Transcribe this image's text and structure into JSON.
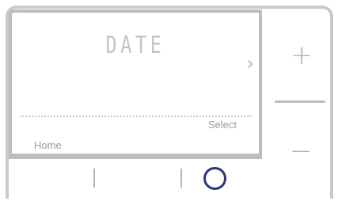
{
  "screen": {
    "title": "DATE",
    "next_glyph": "›",
    "select_label": "Select",
    "home_label": "Home"
  },
  "controls": {
    "plus_glyph": "+",
    "minus_glyph": "−"
  },
  "colors": {
    "frame": "#c9c9c9",
    "text_muted": "#9a9a9a",
    "ring": "#2b3779"
  }
}
